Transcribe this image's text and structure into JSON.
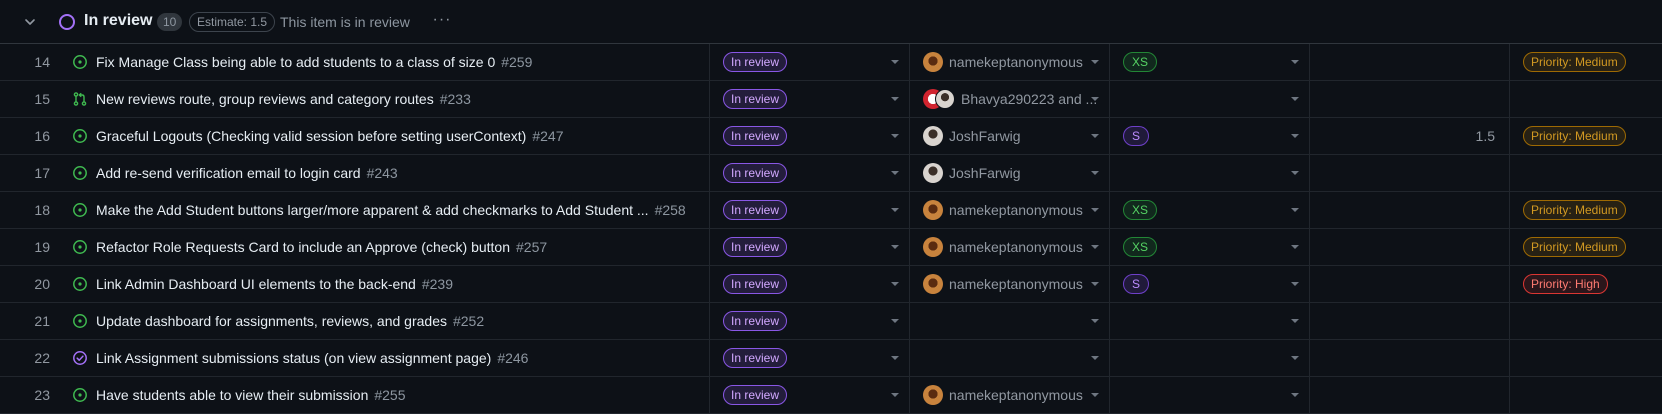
{
  "group": {
    "title": "In review",
    "count": "10",
    "estimate": "Estimate: 1.5",
    "description": "This item is in review",
    "colors": {
      "status_ring": "#a371f7"
    }
  },
  "rows": [
    {
      "num": "14",
      "icon": "issue-open-icon",
      "title": "Fix Manage Class being able to add students to a class of size 0",
      "issue": "#259",
      "status": "In review",
      "assignee": "namekeptanonymous",
      "avatar": "orange",
      "size": "XS",
      "estimate": "",
      "priority": "Priority: Medium"
    },
    {
      "num": "15",
      "icon": "pull-request-icon",
      "title": "New reviews route, group reviews and category routes",
      "issue": "#233",
      "status": "In review",
      "assignee": "Bhavya290223 and ...",
      "avatar": "pair",
      "size": "",
      "estimate": "",
      "priority": ""
    },
    {
      "num": "16",
      "icon": "issue-open-icon",
      "title": "Graceful Logouts (Checking valid session before setting userContext)",
      "issue": "#247",
      "status": "In review",
      "assignee": "JoshFarwig",
      "avatar": "gray",
      "size": "S",
      "estimate": "1.5",
      "priority": "Priority: Medium"
    },
    {
      "num": "17",
      "icon": "issue-open-icon",
      "title": "Add re-send verification email to login card",
      "issue": "#243",
      "status": "In review",
      "assignee": "JoshFarwig",
      "avatar": "gray",
      "size": "",
      "estimate": "",
      "priority": ""
    },
    {
      "num": "18",
      "icon": "issue-open-icon",
      "title": "Make the Add Student buttons larger/more apparent & add checkmarks to Add Student ...",
      "issue": "#258",
      "status": "In review",
      "assignee": "namekeptanonymous",
      "avatar": "orange",
      "size": "XS",
      "estimate": "",
      "priority": "Priority: Medium"
    },
    {
      "num": "19",
      "icon": "issue-open-icon",
      "title": "Refactor Role Requests Card to include an Approve (check) button",
      "issue": "#257",
      "status": "In review",
      "assignee": "namekeptanonymous",
      "avatar": "orange",
      "size": "XS",
      "estimate": "",
      "priority": "Priority: Medium"
    },
    {
      "num": "20",
      "icon": "issue-open-icon",
      "title": "Link Admin Dashboard UI elements to the back-end",
      "issue": "#239",
      "status": "In review",
      "assignee": "namekeptanonymous",
      "avatar": "orange",
      "size": "S",
      "estimate": "",
      "priority": "Priority: High"
    },
    {
      "num": "21",
      "icon": "issue-open-icon",
      "title": "Update dashboard for assignments, reviews, and grades",
      "issue": "#252",
      "status": "In review",
      "assignee": "",
      "avatar": "",
      "size": "",
      "estimate": "",
      "priority": ""
    },
    {
      "num": "22",
      "icon": "issue-closed-icon",
      "title": "Link Assignment submissions status (on view assignment page)",
      "issue": "#246",
      "status": "In review",
      "assignee": "",
      "avatar": "",
      "size": "",
      "estimate": "",
      "priority": ""
    },
    {
      "num": "23",
      "icon": "issue-open-icon",
      "title": "Have students able to view their submission",
      "issue": "#255",
      "status": "In review",
      "assignee": "namekeptanonymous",
      "avatar": "orange",
      "size": "",
      "estimate": "",
      "priority": ""
    }
  ],
  "colors": {
    "background": "#0d1117",
    "open_icon": "#3fb950",
    "closed_icon": "#a371f7",
    "status_purple": "#8957e5",
    "size_green": "#238636",
    "size_purple": "#6e40c9",
    "priority_medium": "#d29922",
    "priority_high": "#f85149"
  }
}
